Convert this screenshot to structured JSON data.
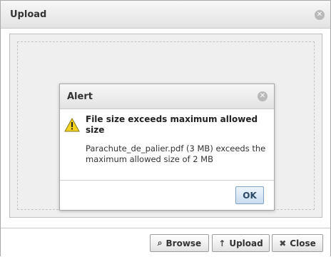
{
  "dialog": {
    "title": "Upload",
    "close_icon": "close-icon",
    "buttons": {
      "browse": {
        "label": "Browse",
        "icon": "search-icon"
      },
      "upload": {
        "label": "Upload",
        "icon": "arrow-up-icon"
      },
      "close": {
        "label": "Close",
        "icon": "close-x-icon"
      }
    }
  },
  "alert": {
    "title": "Alert",
    "icon": "warning-icon",
    "heading": "File size exceeds maximum allowed size",
    "message": "Parachute_de_palier.pdf (3 MB) exceeds the maximum allowed size of 2 MB",
    "ok_label": "OK"
  },
  "colors": {
    "warning_yellow": "#f2d21f",
    "ok_button_border": "#7fa3c6"
  }
}
